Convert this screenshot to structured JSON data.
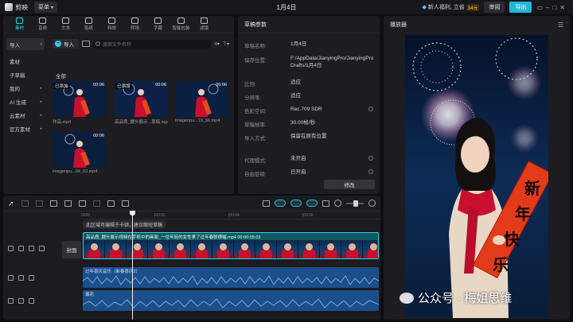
{
  "titlebar": {
    "app_name": "剪映",
    "menu_label": "菜单",
    "doc_title": "1月4日",
    "promo_text": "新人福利, 立省",
    "promo_amount": "34元",
    "review_label": "审阅",
    "export_label": "导出"
  },
  "toolstrip": [
    "素材",
    "音频",
    "文本",
    "贴纸",
    "特效",
    "转场",
    "字幕",
    "智能包装",
    "滤镜"
  ],
  "left_nav": [
    {
      "label": "导入",
      "arrow": "▾"
    },
    {
      "label": "素材",
      "arrow": ""
    },
    {
      "label": "子草稿",
      "arrow": ""
    },
    {
      "label": "我的",
      "arrow": "▸"
    },
    {
      "label": "AI 生成",
      "arrow": "▸"
    },
    {
      "label": "云素材",
      "arrow": "▸"
    },
    {
      "label": "官方素材",
      "arrow": "▸"
    }
  ],
  "media": {
    "import_label": "导入",
    "search_placeholder": "搜索文件名称",
    "sort_label": "≡▾",
    "filter_label": "⊤▾",
    "all_label": "全部",
    "added_label": "已添加",
    "items": [
      {
        "name": "作品.mp4",
        "duration": "00:06",
        "added": true
      },
      {
        "name": "高品质_魏头展示...草稿.mp4",
        "duration": "00:06",
        "added": true
      },
      {
        "name": "imagenpu...19_56.mp4",
        "duration": "00:06",
        "added": false
      },
      {
        "name": "imagenpu...04_03.mp4",
        "duration": "00:06",
        "added": false
      }
    ]
  },
  "params": {
    "title": "草稿参数",
    "rows": [
      {
        "k": "草稿名称:",
        "v": "1月4日",
        "info": false
      },
      {
        "k": "保存位置:",
        "v": "F:/AppData/JianyingPro/JianyingPro Drafts/1月4日",
        "info": false
      },
      {
        "k": "比例:",
        "v": "适应",
        "info": false
      },
      {
        "k": "分辨率:",
        "v": "适应",
        "info": false
      },
      {
        "k": "色彩空间:",
        "v": "Rec.709 SDR",
        "info": true
      },
      {
        "k": "草稿帧率:",
        "v": "30.00帧/秒",
        "info": false
      },
      {
        "k": "导入方式:",
        "v": "保留在原有位置",
        "info": false
      },
      {
        "k": "代理模式:",
        "v": "未开启",
        "info": true
      },
      {
        "k": "自由层级:",
        "v": "已开启",
        "info": true
      }
    ],
    "modify_label": "修改"
  },
  "player": {
    "title": "播放器",
    "banner_line1": "新",
    "banner_line2": "年",
    "banner_line3": "快",
    "banner_line4": "乐",
    "watermark": "公众号 · 梅姐思维"
  },
  "timeline": {
    "ruler_ticks": [
      "0000",
      "|00:02",
      "|00:04",
      "|00:06"
    ],
    "hint": "此区域可编辑于卡顿，建议缩短草稿",
    "cover_label": "封面",
    "video_clip_title": "高品质_魏头展示视频在手机中的画面_一位年轻的女性拿了过年春联横幅.mp4  00:00:05:03",
    "audio1_title": "过年喜庆音乐（新春喜庆2）",
    "audio2_title": "烟花"
  }
}
